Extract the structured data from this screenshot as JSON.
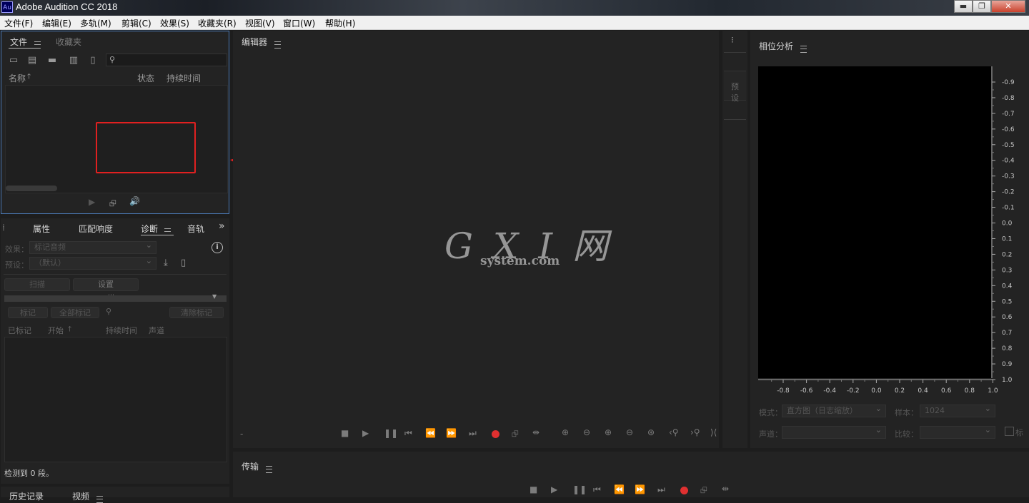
{
  "titlebar": {
    "logo": "Au",
    "title": "Adobe Audition CC 2018",
    "minimize": "▬",
    "restore": "❐",
    "close": "✕"
  },
  "menubar": {
    "items": [
      "文件(F)",
      "编辑(E)",
      "多轨(M)",
      "剪辑(C)",
      "效果(S)",
      "收藏夹(R)",
      "视图(V)",
      "窗口(W)",
      "帮助(H)"
    ]
  },
  "files_panel": {
    "tabs": [
      "文件",
      "收藏夹"
    ],
    "search_placeholder": "",
    "columns": [
      "名称",
      "状态",
      "持续时间"
    ],
    "sort_indicator": "🡑"
  },
  "diag_panel": {
    "tabs": [
      "属性",
      "匹配响度",
      "诊断",
      "音轨"
    ],
    "effect_label": "效果：",
    "effect_value": "标记音频",
    "preset_label": "预设：",
    "preset_value": "（默认）",
    "scan_button": "扫描",
    "settings_button": "设置",
    "mark_button": "标记",
    "mark_all_button": "全部标记",
    "clear_marks_button": "清除标记",
    "columns": [
      "已标记",
      "开始",
      "持续时间",
      "声道"
    ],
    "status": "检测到 0 段。"
  },
  "bottom_left": {
    "tabs": [
      "历史记录",
      "视频"
    ]
  },
  "editor": {
    "title": "编辑器",
    "time": "-"
  },
  "watermark": {
    "main": "G X I 网",
    "sub": "system.com"
  },
  "presets_panel": {
    "label": "预设"
  },
  "phase_panel": {
    "title": "相位分析",
    "y_ticks": [
      "-0.9",
      "-0.8",
      "-0.7",
      "-0.6",
      "-0.5",
      "-0.4",
      "-0.3",
      "-0.2",
      "-0.1",
      "0.0",
      "0.1",
      "0.2",
      "0.3",
      "0.4",
      "0.5",
      "0.6",
      "0.7",
      "0.8",
      "0.9",
      "1.0"
    ],
    "x_ticks": [
      "-0.8",
      "-0.6",
      "-0.4",
      "-0.2",
      "0.0",
      "0.2",
      "0.4",
      "0.6",
      "0.8",
      "1.0"
    ],
    "mode_label": "模式：",
    "mode_value": "直方图（日志缩放）",
    "sample_label": "样本：",
    "sample_value": "1024",
    "channel_label": "声道：",
    "channel_value": "",
    "compare_label": "比较：",
    "compare_value": "",
    "mark_checkbox_label": "标"
  },
  "transport_panel": {
    "title": "传输"
  },
  "colors": {
    "accent_blue": "#4a78b4",
    "record_red": "#e03030",
    "annotation_red": "#e02020"
  }
}
